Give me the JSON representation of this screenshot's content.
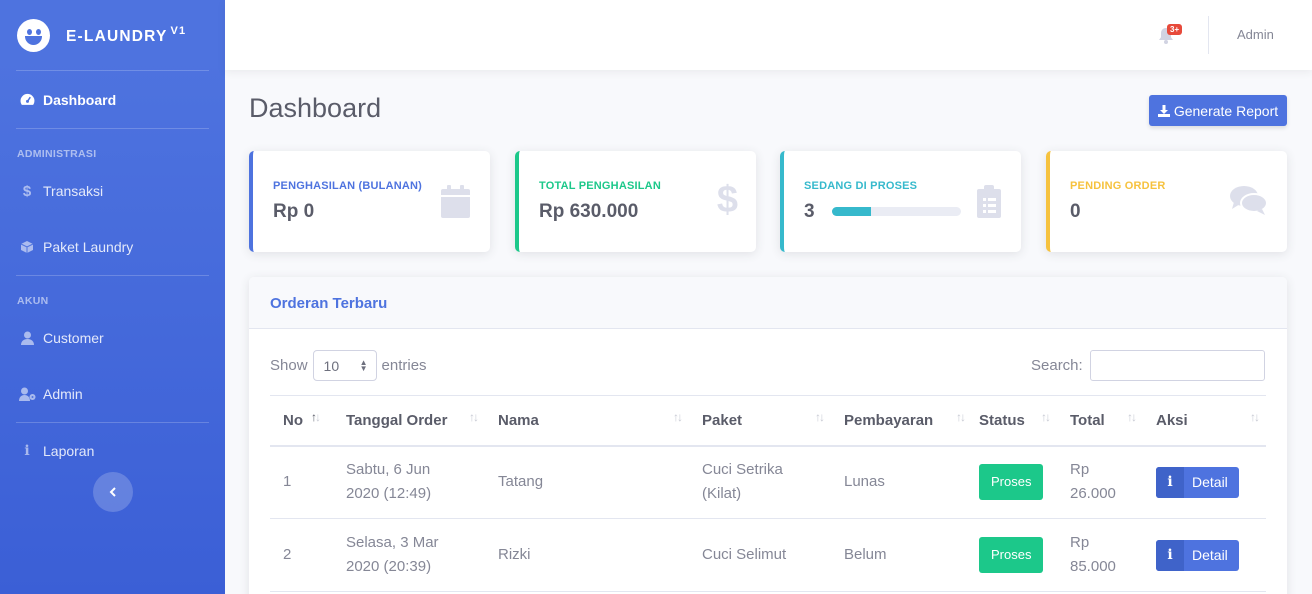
{
  "brand": {
    "name": "E-LAUNDRY",
    "version": "V1"
  },
  "sidebar": {
    "dashboard": "Dashboard",
    "heading_admin": "ADMINISTRASI",
    "transaksi": "Transaksi",
    "paket": "Paket Laundry",
    "heading_akun": "AKUN",
    "customer": "Customer",
    "admin": "Admin",
    "laporan": "Laporan"
  },
  "topbar": {
    "badge": "3+",
    "user": "Admin"
  },
  "page": {
    "title": "Dashboard",
    "report_button": "Generate Report"
  },
  "cards": [
    {
      "label": "PENGHASILAN (BULANAN)",
      "value": "Rp 0",
      "color": "#4e73df",
      "icon": "calendar-icon"
    },
    {
      "label": "TOTAL PENGHASILAN",
      "value": "Rp 630.000",
      "color": "#1cc88a",
      "icon": "dollar-icon"
    },
    {
      "label": "SEDANG DI PROSES",
      "value": "3",
      "color": "#36b9cc",
      "icon": "clipboard-icon",
      "progress": 0.3
    },
    {
      "label": "PENDING ORDER",
      "value": "0",
      "color": "#f6c23e",
      "icon": "comments-icon"
    }
  ],
  "orders": {
    "title": "Orderan Terbaru",
    "show_label": "Show",
    "entries_value": "10",
    "entries_label": "entries",
    "search_label": "Search:",
    "columns": [
      "No",
      "Tanggal Order",
      "Nama",
      "Paket",
      "Pembayaran",
      "Status",
      "Total",
      "Aksi"
    ],
    "rows": [
      {
        "no": "1",
        "tanggal": "Sabtu, 6 Jun 2020 (12:49)",
        "nama": "Tatang",
        "paket": "Cuci Setrika (Kilat)",
        "pembayaran": "Lunas",
        "status": "Proses",
        "total": "Rp 26.000",
        "aksi": "Detail"
      },
      {
        "no": "2",
        "tanggal": "Selasa, 3 Mar 2020 (20:39)",
        "nama": "Rizki",
        "paket": "Cuci Selimut",
        "pembayaran": "Belum",
        "status": "Proses",
        "total": "Rp 85.000",
        "aksi": "Detail"
      }
    ]
  }
}
